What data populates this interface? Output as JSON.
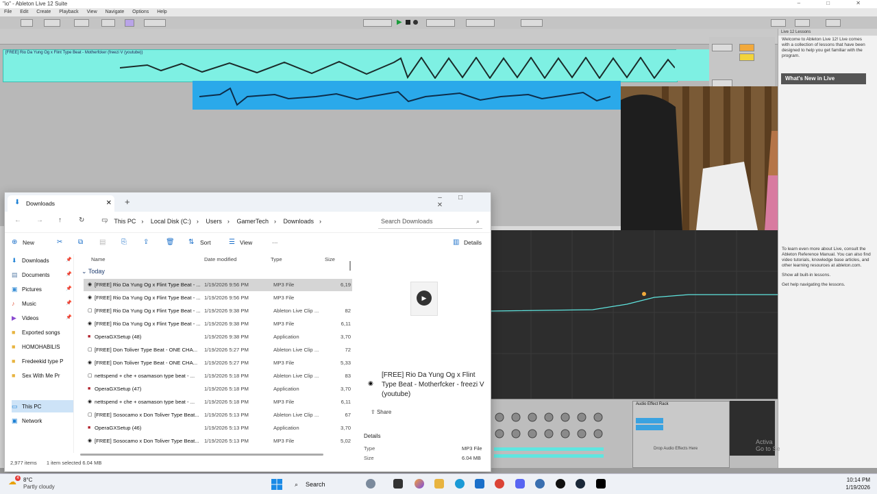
{
  "ableton": {
    "window_title": "\"io\" - Ableton Live 12 Suite",
    "menu": [
      "File",
      "Edit",
      "Create",
      "Playback",
      "View",
      "Navigate",
      "Options",
      "Help"
    ],
    "clip_label": "[FREE] Rio Da Yung Og x Flint Type Beat - Motherfcker (freezi V (youtube))",
    "lessons": {
      "header": "Live 12 Lessons",
      "intro": "Welcome to Ableton Live 12! Live comes with a collection of lessons that have been designed to help you get familiar with the program.",
      "whats_new": "What's New in Live",
      "body1": "To learn even more about Live, consult the Ableton Reference Manual. You can also find video tutorials, knowledge base articles, and other learning resources at ableton.com.",
      "body2": "Show all built-in lessons.",
      "body3": "Get help navigating the lessons."
    },
    "rack_title": "Audio Effect Rack",
    "rack_drop": "Drop Audio Effects Here",
    "activate_line1": "Activa",
    "activate_line2": "Go to Se",
    "accent_cyan": "#7ef0e3",
    "accent_blue": "#2aa9ea"
  },
  "explorer": {
    "tab_title": "Downloads",
    "breadcrumb": [
      "This PC",
      "Local Disk (C:)",
      "Users",
      "GamerTech",
      "Downloads"
    ],
    "search_placeholder": "Search Downloads",
    "commands": {
      "new": "New",
      "sort": "Sort",
      "view": "View",
      "more": "···",
      "details": "Details"
    },
    "nav_items": [
      {
        "label": "Downloads",
        "icon": "download-icon",
        "pinned": true
      },
      {
        "label": "Documents",
        "icon": "documents-icon",
        "pinned": true
      },
      {
        "label": "Pictures",
        "icon": "pictures-icon",
        "pinned": true
      },
      {
        "label": "Music",
        "icon": "music-icon",
        "pinned": true
      },
      {
        "label": "Videos",
        "icon": "videos-icon",
        "pinned": true
      },
      {
        "label": "Exported songs",
        "icon": "folder-icon",
        "pinned": false
      },
      {
        "label": "HOMOHABILIS",
        "icon": "folder-icon",
        "pinned": false
      },
      {
        "label": "Fredeekid type P",
        "icon": "folder-icon",
        "pinned": false
      },
      {
        "label": "Sex With Me Pr",
        "icon": "folder-icon",
        "pinned": false
      },
      {
        "label": "This PC",
        "icon": "this-pc-icon",
        "pinned": false
      },
      {
        "label": "Network",
        "icon": "network-icon",
        "pinned": false
      }
    ],
    "columns": [
      "Name",
      "Date modified",
      "Type",
      "Size"
    ],
    "group": "Today",
    "files": [
      {
        "name": "[FREE] Rio Da Yung Og x Flint Type Beat - ...",
        "date": "1/19/2026 9:56 PM",
        "type": "MP3 File",
        "size": "6,19"
      },
      {
        "name": "[FREE] Rio Da Yung Og x Flint Type Beat - ...",
        "date": "1/19/2026 9:56 PM",
        "type": "MP3 File",
        "size": ""
      },
      {
        "name": "[FREE] Rio Da Yung Og x Flint Type Beat - ...",
        "date": "1/19/2026 9:38 PM",
        "type": "Ableton Live Clip ...",
        "size": "82"
      },
      {
        "name": "[FREE] Rio Da Yung Og x Flint Type Beat - ...",
        "date": "1/19/2026 9:38 PM",
        "type": "MP3 File",
        "size": "6,11"
      },
      {
        "name": "OperaGXSetup (48)",
        "date": "1/19/2026 9:38 PM",
        "type": "Application",
        "size": "3,70"
      },
      {
        "name": "[FREE] Don Toliver Type Beat - ONE CHA...",
        "date": "1/19/2026 5:27 PM",
        "type": "Ableton Live Clip ...",
        "size": "72"
      },
      {
        "name": "[FREE] Don Toliver Type Beat - ONE CHA...",
        "date": "1/19/2026 5:27 PM",
        "type": "MP3 File",
        "size": "5,33"
      },
      {
        "name": "nettspend + che + osamason type beat - ...",
        "date": "1/19/2026 5:18 PM",
        "type": "Ableton Live Clip ...",
        "size": "83"
      },
      {
        "name": "OperaGXSetup (47)",
        "date": "1/19/2026 5:18 PM",
        "type": "Application",
        "size": "3,70"
      },
      {
        "name": "nettspend + che + osamason type beat - ...",
        "date": "1/19/2026 5:18 PM",
        "type": "MP3 File",
        "size": "6,11"
      },
      {
        "name": "[FREE] Sosocamo x Don Toliver Type Beat...",
        "date": "1/19/2026 5:13 PM",
        "type": "Ableton Live Clip ...",
        "size": "67"
      },
      {
        "name": "OperaGXSetup (46)",
        "date": "1/19/2026 5:13 PM",
        "type": "Application",
        "size": "3,70"
      },
      {
        "name": "[FREE] Sosocamo x Don Toliver Type Beat...",
        "date": "1/19/2026 5:13 PM",
        "type": "MP3 File",
        "size": "5,02"
      }
    ],
    "status": {
      "count": "2,977 items",
      "selected": "1 item selected  6.04 MB"
    },
    "details_pane": {
      "file_name": "[FREE] Rio Da Yung Og x Flint Type Beat - Motherfcker - freezi V (youtube)",
      "share": "Share",
      "section": "Details",
      "type_label": "Type",
      "type_value": "MP3 File",
      "size_label": "Size",
      "size_value": "6.04 MB"
    }
  },
  "taskbar": {
    "weather_temp": "8°C",
    "weather_desc": "Partly cloudy",
    "weather_badge": "4",
    "search": "Search",
    "time": "10:14 PM",
    "date": "1/19/2026"
  }
}
